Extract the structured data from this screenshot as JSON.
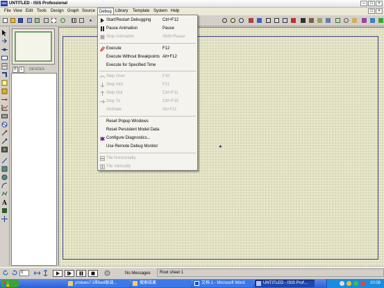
{
  "window": {
    "title": "UNTITLED - ISIS Professional",
    "logo_text": "ISIS"
  },
  "menubar": [
    {
      "label": "File"
    },
    {
      "label": "View"
    },
    {
      "label": "Edit"
    },
    {
      "label": "Tools"
    },
    {
      "label": "Design"
    },
    {
      "label": "Graph"
    },
    {
      "label": "Source"
    },
    {
      "label": "Debug"
    },
    {
      "label": "Library"
    },
    {
      "label": "Template"
    },
    {
      "label": "System"
    },
    {
      "label": "Help"
    }
  ],
  "debug_menu": {
    "items": [
      {
        "label": "Start/Restart Debugging",
        "shortcut": "Ctrl+F12",
        "enabled": true
      },
      {
        "label": "Pause Animation",
        "shortcut": "Pause",
        "enabled": true
      },
      {
        "label": "Stop Animation",
        "shortcut": "Shift+Pause",
        "enabled": false
      },
      {
        "label": "Execute",
        "shortcut": "F12",
        "enabled": true
      },
      {
        "label": "Execute Without Breakpoints",
        "shortcut": "Alt+F12",
        "enabled": true
      },
      {
        "label": "Execute for Specified Time",
        "shortcut": "",
        "enabled": true
      },
      {
        "label": "Step Over",
        "shortcut": "F10",
        "enabled": false
      },
      {
        "label": "Step Into",
        "shortcut": "F11",
        "enabled": false
      },
      {
        "label": "Step Out",
        "shortcut": "Ctrl+F11",
        "enabled": false
      },
      {
        "label": "Step To",
        "shortcut": "Ctrl+F10",
        "enabled": false
      },
      {
        "label": "Animate",
        "shortcut": "Alt+F11",
        "enabled": false
      },
      {
        "label": "Reset Popup Windows",
        "shortcut": "",
        "enabled": true
      },
      {
        "label": "Reset Persistent Model Data",
        "shortcut": "",
        "enabled": true
      },
      {
        "label": "Configure Diagnostics...",
        "shortcut": "",
        "enabled": true
      },
      {
        "label": "Use Remote Debug Monitor",
        "shortcut": "",
        "enabled": true
      },
      {
        "label": "Tile Horizontally",
        "shortcut": "",
        "enabled": false
      },
      {
        "label": "Tile Vertically",
        "shortcut": "",
        "enabled": false
      }
    ]
  },
  "device_panel": {
    "tab_p": "P",
    "tab_l": "L",
    "title": "DEVICES"
  },
  "bottom": {
    "angle": "0",
    "status": "No Messages",
    "sheet": "Root sheet 1"
  },
  "taskbar": {
    "items": [
      {
        "label": "protues7.5和keil联调..."
      },
      {
        "label": "搜索结果"
      },
      {
        "label": "文档 1 - Microsoft Word"
      },
      {
        "label": "UNTITLED - ISIS Prof..."
      }
    ],
    "clock": "10:08"
  },
  "colors": {
    "canvas": "#e8e6c8",
    "sheet_border": "#3c3c8c",
    "taskbar": "#2c5ed4"
  }
}
